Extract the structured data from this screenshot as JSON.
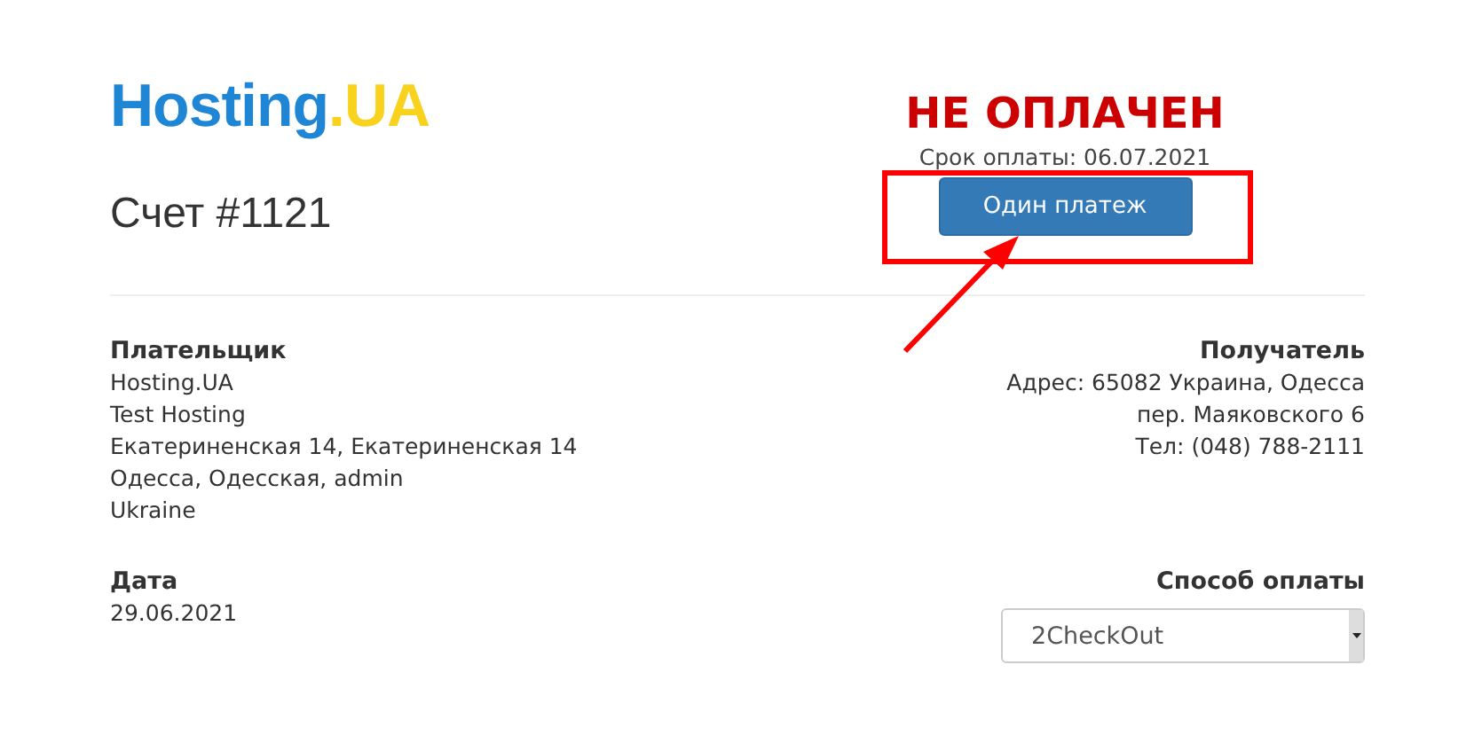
{
  "logo": {
    "name": "Hosting",
    "suffix": ".UA"
  },
  "invoice_title": "Счет #1121",
  "status": {
    "text": "НЕ ОПЛАЧЕН",
    "paid": false,
    "due": "Срок оплаты: 06.07.2021",
    "button": "Один платеж"
  },
  "payer": {
    "heading": "Плательщик",
    "lines": [
      "Hosting.UA",
      "Test Hosting",
      "Екатериненская 14, Екатериненская 14",
      "Одесса, Одесская, admin",
      "Ukraine"
    ]
  },
  "recipient": {
    "heading": "Получатель",
    "lines": [
      "Адрес: 65082 Украина, Одесса",
      "пер. Маяковского 6",
      "Тел: (048) 788-2111"
    ]
  },
  "date": {
    "heading": "Дата",
    "value": "29.06.2021"
  },
  "payment_method": {
    "heading": "Способ оплаты",
    "value": "2CheckOut"
  },
  "annotation": {
    "highlight_box": true,
    "arrow": true
  }
}
